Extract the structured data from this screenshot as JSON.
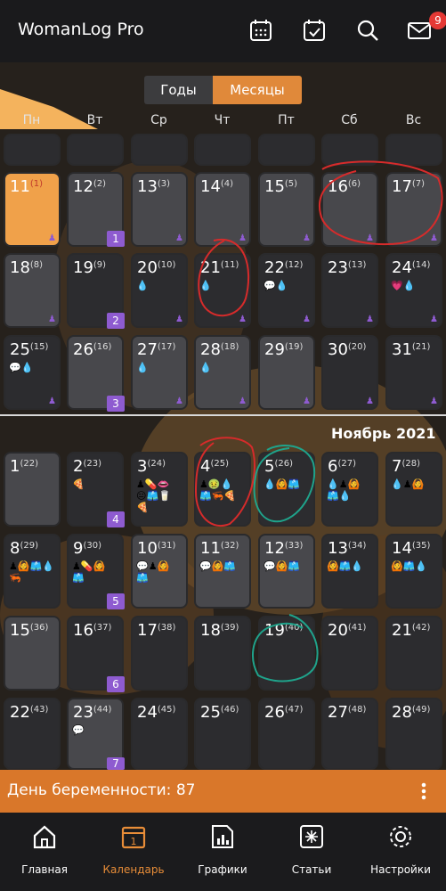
{
  "app": {
    "title": "WomanLog Pro",
    "notif_count": "9"
  },
  "toolbar": {
    "icons": [
      "calendar-grid-icon",
      "calendar-check-icon",
      "search-icon",
      "mail-icon"
    ]
  },
  "segment": {
    "years": "Годы",
    "months": "Месяцы"
  },
  "weekdays": [
    "Пн",
    "Вт",
    "Ср",
    "Чт",
    "Пт",
    "Сб",
    "Вс"
  ],
  "october": {
    "rows": [
      {
        "week": "1",
        "days": [
          {
            "d": "11",
            "c": "(1)"
          },
          {
            "d": "12",
            "c": "(2)"
          },
          {
            "d": "13",
            "c": "(3)"
          },
          {
            "d": "14",
            "c": "(4)"
          },
          {
            "d": "15",
            "c": "(5)"
          },
          {
            "d": "16",
            "c": "(6)"
          },
          {
            "d": "17",
            "c": "(7)"
          }
        ]
      },
      {
        "week": "2",
        "days": [
          {
            "d": "18",
            "c": "(8)"
          },
          {
            "d": "19",
            "c": "(9)"
          },
          {
            "d": "20",
            "c": "(10)"
          },
          {
            "d": "21",
            "c": "(11)"
          },
          {
            "d": "22",
            "c": "(12)"
          },
          {
            "d": "23",
            "c": "(13)"
          },
          {
            "d": "24",
            "c": "(14)"
          }
        ]
      },
      {
        "week": "3",
        "days": [
          {
            "d": "25",
            "c": "(15)"
          },
          {
            "d": "26",
            "c": "(16)"
          },
          {
            "d": "27",
            "c": "(17)"
          },
          {
            "d": "28",
            "c": "(18)"
          },
          {
            "d": "29",
            "c": "(19)"
          },
          {
            "d": "30",
            "c": "(20)"
          },
          {
            "d": "31",
            "c": "(21)"
          }
        ]
      }
    ]
  },
  "november": {
    "label": "Ноябрь  2021",
    "rows": [
      {
        "week": "4",
        "days": [
          {
            "d": "1",
            "c": "(22)"
          },
          {
            "d": "2",
            "c": "(23)"
          },
          {
            "d": "3",
            "c": "(24)"
          },
          {
            "d": "4",
            "c": "(25)"
          },
          {
            "d": "5",
            "c": "(26)"
          },
          {
            "d": "6",
            "c": "(27)"
          },
          {
            "d": "7",
            "c": "(28)"
          }
        ]
      },
      {
        "week": "5",
        "days": [
          {
            "d": "8",
            "c": "(29)"
          },
          {
            "d": "9",
            "c": "(30)"
          },
          {
            "d": "10",
            "c": "(31)"
          },
          {
            "d": "11",
            "c": "(32)"
          },
          {
            "d": "12",
            "c": "(33)"
          },
          {
            "d": "13",
            "c": "(34)"
          },
          {
            "d": "14",
            "c": "(35)"
          }
        ]
      },
      {
        "week": "6",
        "days": [
          {
            "d": "15",
            "c": "(36)"
          },
          {
            "d": "16",
            "c": "(37)"
          },
          {
            "d": "17",
            "c": "(38)"
          },
          {
            "d": "18",
            "c": "(39)"
          },
          {
            "d": "19",
            "c": "(40)"
          },
          {
            "d": "20",
            "c": "(41)"
          },
          {
            "d": "21",
            "c": "(42)"
          }
        ]
      },
      {
        "week": "7",
        "days": [
          {
            "d": "22",
            "c": "(43)"
          },
          {
            "d": "23",
            "c": "(44)"
          },
          {
            "d": "24",
            "c": "(45)"
          },
          {
            "d": "25",
            "c": "(46)"
          },
          {
            "d": "26",
            "c": "(47)"
          },
          {
            "d": "27",
            "c": "(48)"
          },
          {
            "d": "28",
            "c": "(49)"
          }
        ]
      }
    ]
  },
  "pregnancy": {
    "text": "День беременности: 87"
  },
  "nav": [
    {
      "label": "Главная",
      "icon": "home-icon"
    },
    {
      "label": "Календарь",
      "icon": "calendar-icon",
      "badge": "1"
    },
    {
      "label": "Графики",
      "icon": "chart-icon"
    },
    {
      "label": "Статьи",
      "icon": "articles-icon"
    },
    {
      "label": "Настройки",
      "icon": "settings-icon"
    }
  ],
  "colors": {
    "accent": "#e0893a",
    "purple": "#8e5bd0",
    "cell": "#48484c"
  }
}
